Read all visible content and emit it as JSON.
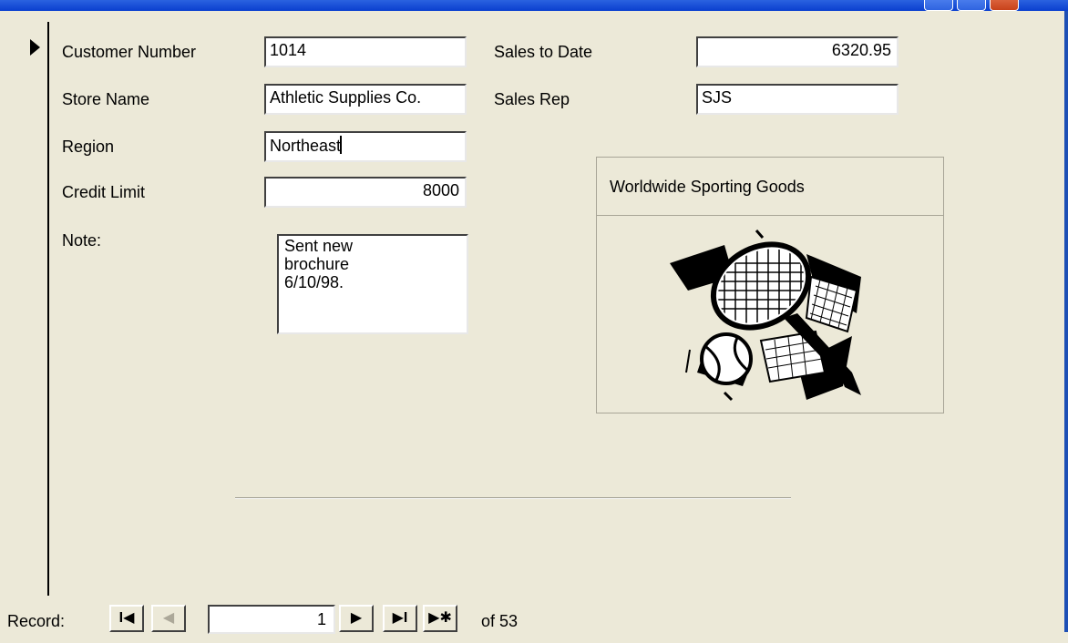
{
  "form": {
    "customer_number": {
      "label": "Customer Number",
      "value": "1014"
    },
    "store_name": {
      "label": "Store Name",
      "value": "Athletic Supplies Co."
    },
    "region": {
      "label": "Region",
      "value": "Northeast"
    },
    "credit_limit": {
      "label": "Credit Limit",
      "value": "8000"
    },
    "note": {
      "label": "Note:",
      "value": "Sent new\nbrochure\n6/10/98."
    },
    "sales_to_date": {
      "label": "Sales to Date",
      "value": "6320.95"
    },
    "sales_rep": {
      "label": "Sales Rep",
      "value": "SJS"
    }
  },
  "logo": {
    "title": "Worldwide Sporting Goods",
    "icon": "tennis-racket-ball-clipart"
  },
  "navigator": {
    "label": "Record:",
    "current": "1",
    "total_text": "of  53",
    "first_glyph": "I◀",
    "prev_glyph": "◀",
    "next_glyph": "▶",
    "last_glyph": "▶I",
    "new_glyph": "▶✱"
  },
  "window_controls": [
    "minimize",
    "maximize",
    "close"
  ]
}
